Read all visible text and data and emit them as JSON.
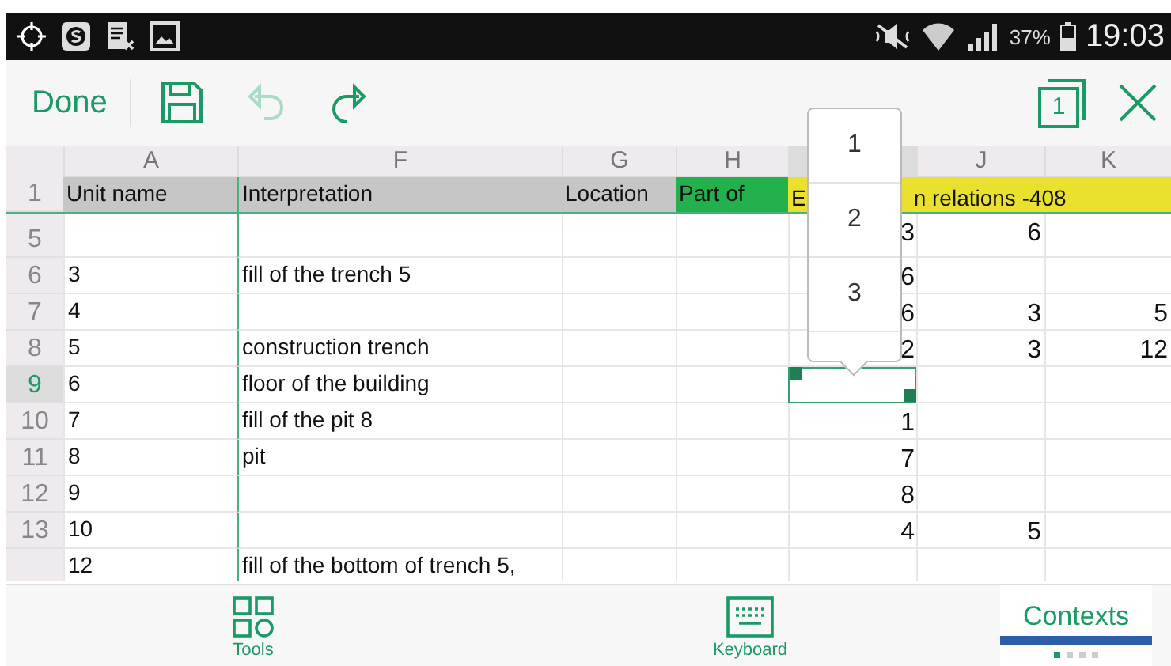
{
  "status_bar": {
    "battery": "37%",
    "time": "19:03"
  },
  "toolbar": {
    "done": "Done",
    "undo": {
      "disabled": true
    },
    "redo": {
      "disabled": false
    },
    "sheet_number": "1"
  },
  "columns": [
    {
      "label": "A",
      "selected": false
    },
    {
      "label": "F",
      "selected": false
    },
    {
      "label": "G",
      "selected": false
    },
    {
      "label": "H",
      "selected": false
    },
    {
      "selected": true
    },
    {
      "label": "J",
      "selected": false
    },
    {
      "label": "K",
      "selected": false
    }
  ],
  "header_row": {
    "number": "1",
    "cells": [
      {
        "text": "Unit name",
        "color": "#c6c6c6"
      },
      {
        "text": "Interpretation",
        "color": "#c6c6c6"
      },
      {
        "text": "Location",
        "color": "#c6c6c6"
      },
      {
        "text": "Part of",
        "color": "#22b14c"
      },
      {
        "parts": [
          "E",
          "n relations -408"
        ],
        "color": "#e9e12e"
      }
    ]
  },
  "rows": [
    {
      "number": "5",
      "selected": false,
      "cells": {
        "I": "3",
        "J": "6"
      }
    },
    {
      "number": "6",
      "selected": false,
      "cells": {
        "A": "3",
        "F": "fill of the trench 5",
        "I": "6"
      }
    },
    {
      "number": "7",
      "selected": false,
      "cells": {
        "A": "4",
        "I": "6",
        "J": "3",
        "K": "5"
      }
    },
    {
      "number": "8",
      "selected": false,
      "cells": {
        "A": "5",
        "F": "construction trench",
        "I": "2",
        "J": "3",
        "K": "12"
      }
    },
    {
      "number": "9",
      "selected": true,
      "cells": {
        "A": "6",
        "F": "floor of the building"
      }
    },
    {
      "number": "10",
      "selected": false,
      "cells": {
        "A": "7",
        "F": "fill of the pit 8",
        "I": "1"
      }
    },
    {
      "number": "11",
      "selected": false,
      "cells": {
        "A": "8",
        "F": "pit",
        "I": "7"
      }
    },
    {
      "number": "12",
      "selected": false,
      "cells": {
        "A": "9",
        "I": "8"
      }
    },
    {
      "number": "13",
      "selected": false,
      "cells": {
        "A": "10",
        "I": "4",
        "J": "5"
      }
    },
    {
      "selected": false,
      "cells": {
        "A": "12",
        "F": "fill of the bottom of trench 5,"
      }
    }
  ],
  "popup": {
    "items": [
      "1",
      "2",
      "3"
    ]
  },
  "bottom_bar": {
    "items": [
      {
        "kind": "tools",
        "label": "Tools"
      },
      {
        "kind": "keyboard",
        "label": "Keyboard"
      }
    ],
    "tab": {
      "label": "Contexts",
      "selected": true
    },
    "page_dots": [
      {
        "selected": true
      },
      {
        "selected": false
      },
      {
        "selected": false
      },
      {
        "selected": false
      }
    ]
  }
}
